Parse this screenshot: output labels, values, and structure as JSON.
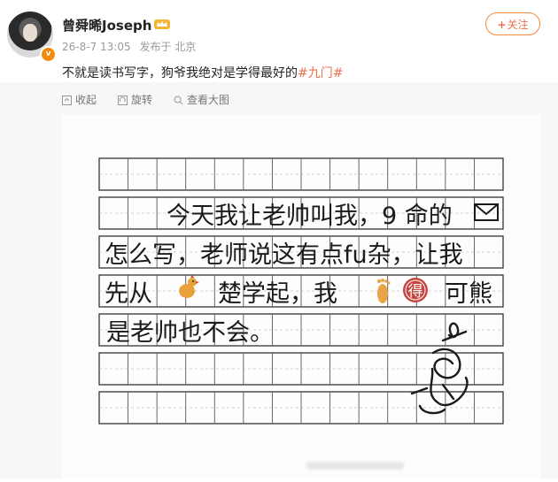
{
  "author": {
    "name": "曾舜晞Joseph",
    "verified_badge": "v",
    "badge_icon": "crown-icon"
  },
  "meta": {
    "time": "26-8-7 13:05",
    "source": "发布于 北京"
  },
  "follow_button": {
    "plus": "+",
    "label": "关注"
  },
  "post": {
    "text": "不就是读书写字，狗爷我绝对是学得最好的",
    "topic": "#九门#"
  },
  "toolbar": {
    "collapse": "收起",
    "rotate": "旋转",
    "view_large": "查看大图"
  },
  "handwriting": {
    "line1": "今天我让老帅叫我，9 命的",
    "line2": "怎么写，老师说这有点fu杂，让我",
    "line3_a": "先从",
    "line3_b": "楚学起，我",
    "line3_c": "可熊",
    "line4": "是老帅也不会。",
    "stamp_char": "得"
  },
  "colors": {
    "accent": "#eb7350",
    "grid": "#333333",
    "paper": "#fdfdfd"
  }
}
